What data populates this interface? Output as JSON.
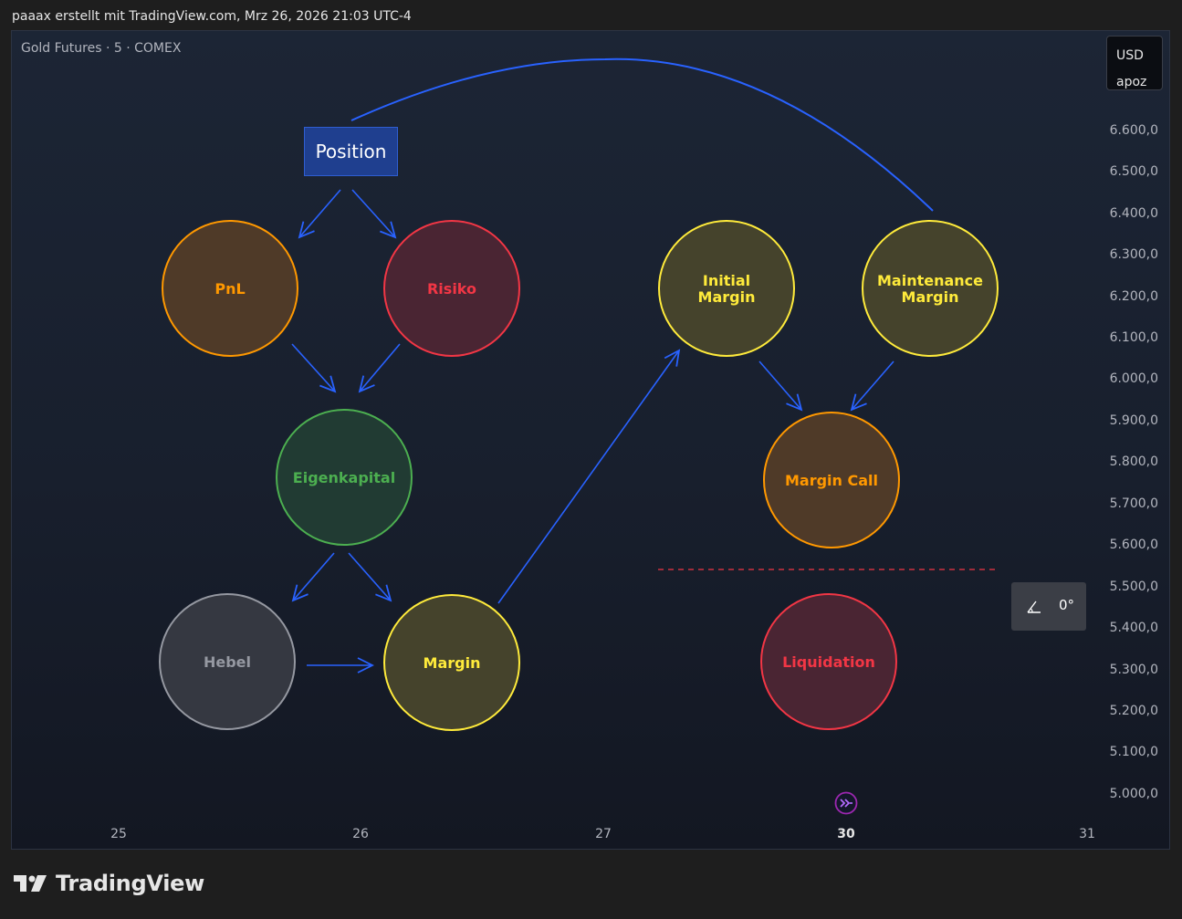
{
  "header": {
    "attribution": "paaax erstellt mit TradingView.com, Mrz 26, 2026 21:03 UTC-4"
  },
  "chart": {
    "symbol_title": "Gold Futures · 5 · COMEX",
    "currency": "USD",
    "currency_sub": "apoz",
    "price_axis": [
      "6.600,0",
      "6.500,0",
      "6.400,0",
      "6.300,0",
      "6.200,0",
      "6.100,0",
      "6.000,0",
      "5.900,0",
      "5.800,0",
      "5.700,0",
      "5.600,0",
      "5.500,0",
      "5.400,0",
      "5.300,0",
      "5.200,0",
      "5.100,0",
      "5.000,0"
    ],
    "time_axis": [
      "25",
      "26",
      "27",
      "30",
      "31"
    ],
    "angle_tool": {
      "value": "0°"
    }
  },
  "diagram": {
    "position": "Position",
    "pnl": "PnL",
    "risiko": "Risiko",
    "eigenkapital": "Eigenkapital",
    "hebel": "Hebel",
    "margin": "Margin",
    "initial_margin": [
      "Initial",
      "Margin"
    ],
    "maintenance_margin": [
      "Maintenance",
      "Margin"
    ],
    "margin_call": "Margin Call",
    "liquidation": "Liquidation"
  },
  "colors": {
    "arrow": "#2962ff",
    "orange": "#ff9800",
    "red": "#f23645",
    "green": "#4caf50",
    "gray": "#9598a1",
    "yellow": "#ffeb3b"
  },
  "footer": {
    "brand": "TradingView"
  }
}
